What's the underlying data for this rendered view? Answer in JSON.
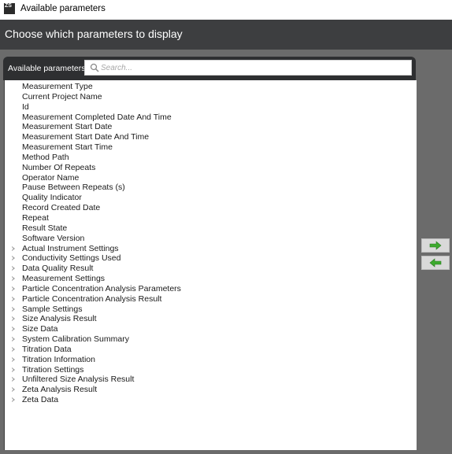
{
  "window": {
    "title": "Available parameters",
    "app_icon_text": "ZS",
    "app_icon": "zetasizer-app-icon"
  },
  "header": {
    "title": "Choose which parameters to display"
  },
  "panel": {
    "label": "Available parameters",
    "search": {
      "placeholder": "Search...",
      "value": "",
      "icon": "search-icon"
    }
  },
  "parameters": [
    {
      "label": "Measurement Type",
      "expandable": false
    },
    {
      "label": "Current Project Name",
      "expandable": false
    },
    {
      "label": "Id",
      "expandable": false
    },
    {
      "label": "Measurement Completed Date And Time",
      "expandable": false
    },
    {
      "label": "Measurement Start Date",
      "expandable": false
    },
    {
      "label": "Measurement Start Date And Time",
      "expandable": false
    },
    {
      "label": "Measurement Start Time",
      "expandable": false
    },
    {
      "label": "Method Path",
      "expandable": false
    },
    {
      "label": "Number Of Repeats",
      "expandable": false
    },
    {
      "label": "Operator Name",
      "expandable": false
    },
    {
      "label": "Pause Between Repeats (s)",
      "expandable": false
    },
    {
      "label": "Quality Indicator",
      "expandable": false
    },
    {
      "label": "Record Created Date",
      "expandable": false
    },
    {
      "label": "Repeat",
      "expandable": false
    },
    {
      "label": "Result State",
      "expandable": false
    },
    {
      "label": "Software Version",
      "expandable": false
    },
    {
      "label": "Actual Instrument Settings",
      "expandable": true
    },
    {
      "label": "Conductivity Settings Used",
      "expandable": true
    },
    {
      "label": "Data Quality Result",
      "expandable": true
    },
    {
      "label": "Measurement Settings",
      "expandable": true
    },
    {
      "label": "Particle Concentration Analysis Parameters",
      "expandable": true
    },
    {
      "label": "Particle Concentration Analysis Result",
      "expandable": true
    },
    {
      "label": "Sample Settings",
      "expandable": true
    },
    {
      "label": "Size Analysis Result",
      "expandable": true
    },
    {
      "label": "Size Data",
      "expandable": true
    },
    {
      "label": "System Calibration Summary",
      "expandable": true
    },
    {
      "label": "Titration Data",
      "expandable": true
    },
    {
      "label": "Titration Information",
      "expandable": true
    },
    {
      "label": "Titration Settings",
      "expandable": true
    },
    {
      "label": "Unfiltered Size Analysis Result",
      "expandable": true
    },
    {
      "label": "Zeta Analysis Result",
      "expandable": true
    },
    {
      "label": "Zeta Data",
      "expandable": true
    }
  ],
  "buttons": {
    "add": {
      "icon": "arrow-right-icon",
      "color": "#3daa2e"
    },
    "remove": {
      "icon": "arrow-left-icon",
      "color": "#3daa2e"
    }
  },
  "colors": {
    "header_bg": "#3d3e40",
    "workspace_bg": "#6b6b6b",
    "panel_bar_bg": "#2e2f31",
    "arrow_green": "#3daa2e"
  }
}
